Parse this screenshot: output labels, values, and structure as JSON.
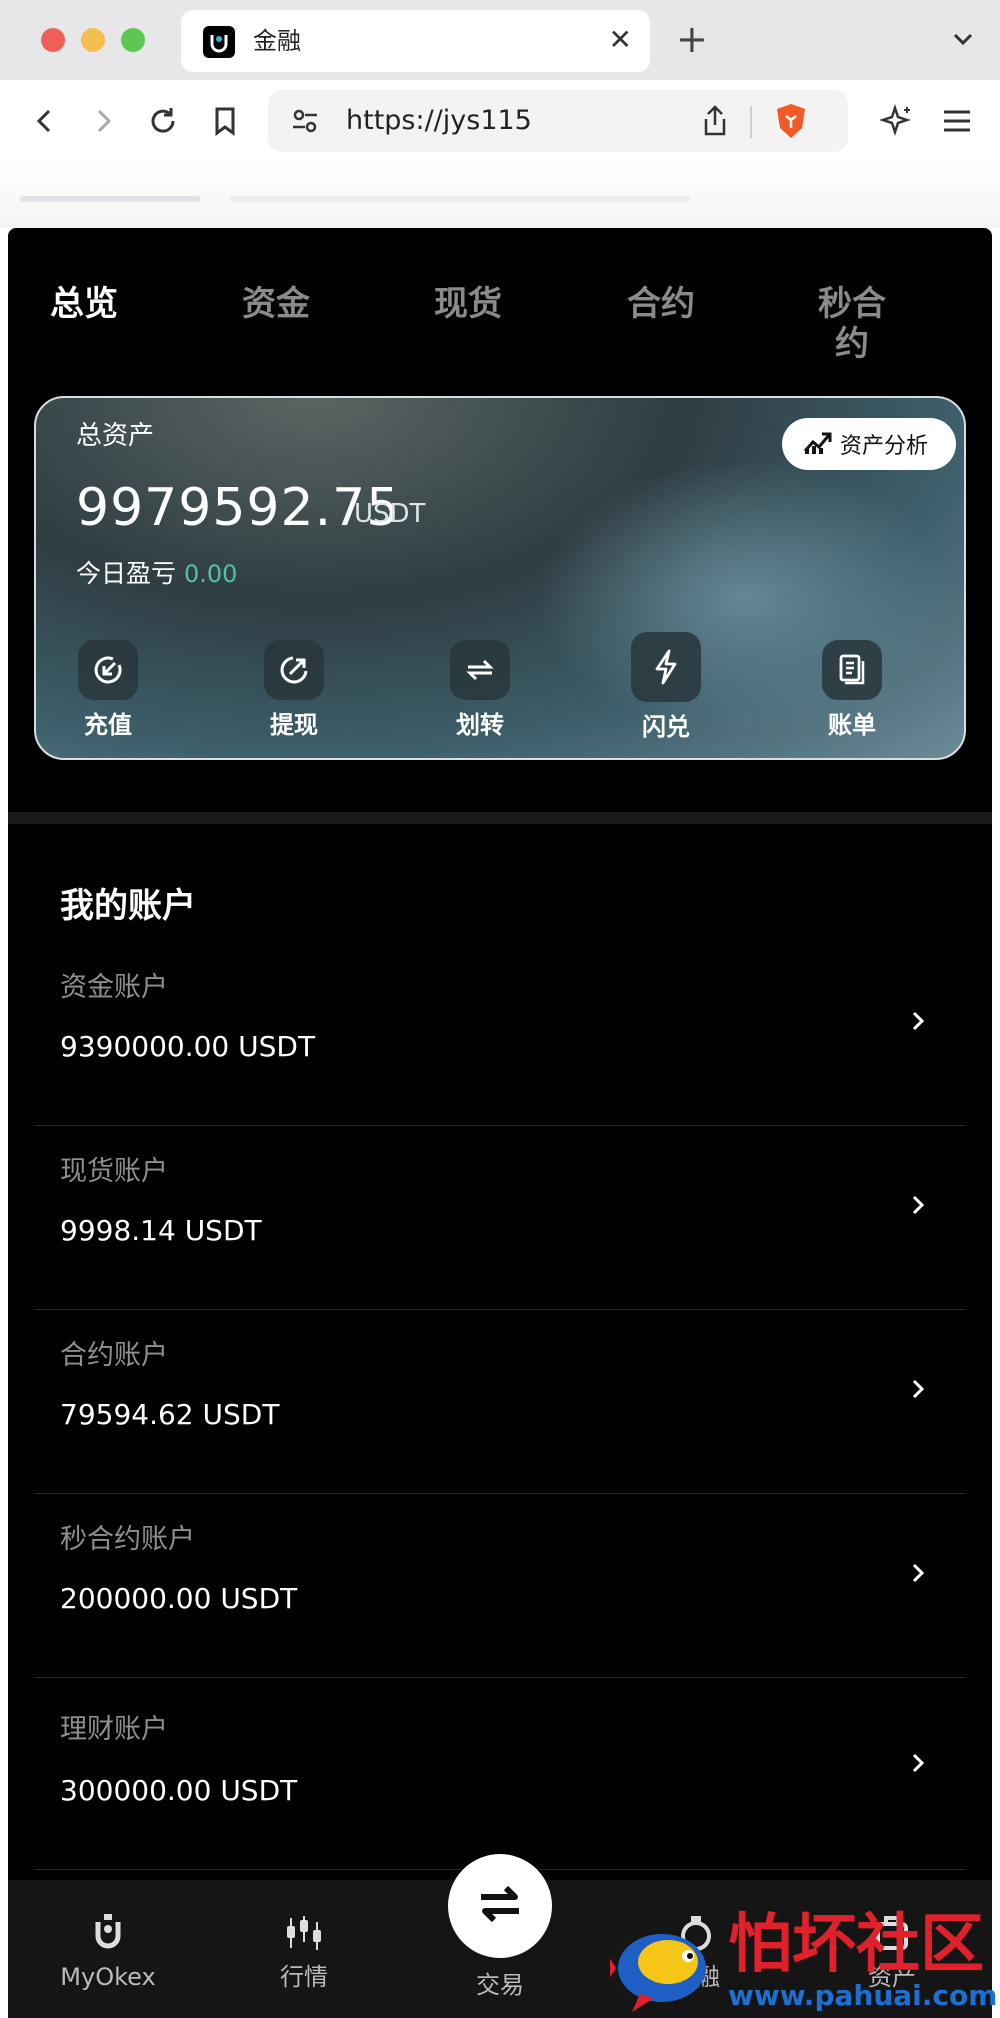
{
  "browser": {
    "tab_title": "金融",
    "url": "https://jys115"
  },
  "app": {
    "top_tabs": [
      "总览",
      "资金",
      "现货",
      "合约",
      "秒合\n约"
    ],
    "card": {
      "title": "总资产",
      "analysis_label": "资产分析",
      "total_value": "9979592.75",
      "total_unit": "USDT",
      "pnl_label": "今日盈亏",
      "pnl_value": "0.00",
      "actions": [
        {
          "label": "充值",
          "icon": "deposit-icon"
        },
        {
          "label": "提现",
          "icon": "withdraw-icon"
        },
        {
          "label": "划转",
          "icon": "transfer-icon"
        },
        {
          "label": "闪兑",
          "icon": "flash-swap-icon"
        },
        {
          "label": "账单",
          "icon": "bill-icon"
        }
      ]
    },
    "section_title": "我的账户",
    "accounts": [
      {
        "name": "资金账户",
        "value": "9390000.00 USDT"
      },
      {
        "name": "现货账户",
        "value": "9998.14 USDT"
      },
      {
        "name": "合约账户",
        "value": "79594.62 USDT"
      },
      {
        "name": "秒合约账户",
        "value": "200000.00 USDT"
      },
      {
        "name": "理财账户",
        "value": "300000.00 USDT"
      }
    ],
    "bottom_nav": [
      {
        "label": "MyOkex",
        "icon": "home-logo-icon"
      },
      {
        "label": "行情",
        "icon": "market-icon"
      },
      {
        "label": "交易",
        "icon": "swap-arrows-icon"
      },
      {
        "label": "金融",
        "icon": "finance-icon"
      },
      {
        "label": "资产",
        "icon": "assets-icon"
      }
    ]
  },
  "watermark": {
    "text": "怕坏社区",
    "url": "www.pahuai.com"
  }
}
